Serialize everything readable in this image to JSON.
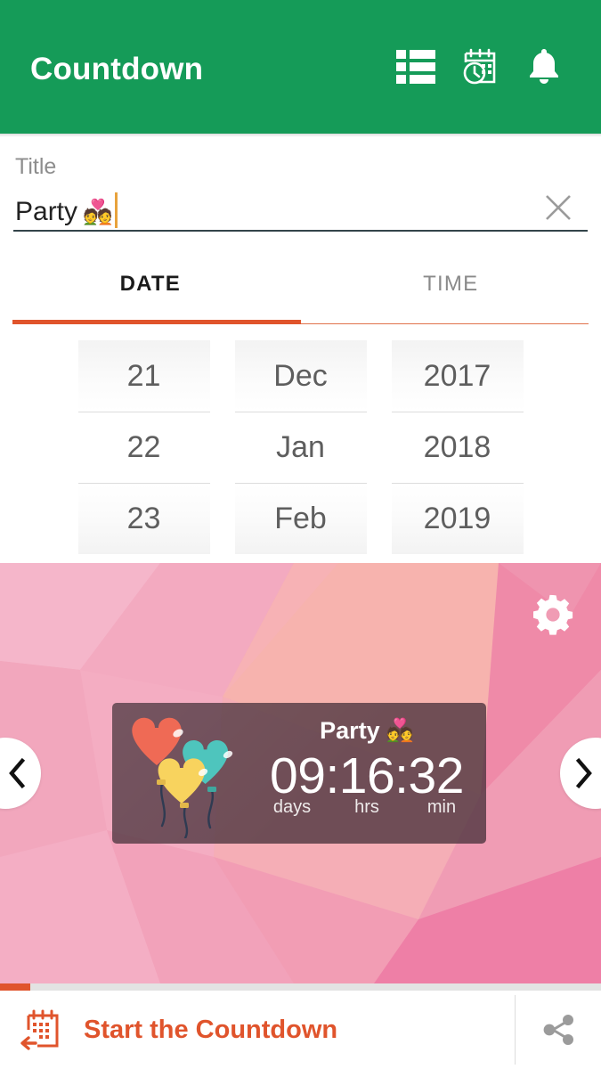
{
  "appbar": {
    "title": "Countdown",
    "actions": [
      {
        "name": "list-icon",
        "label": "List"
      },
      {
        "name": "calendar-clock-icon",
        "label": "Events"
      },
      {
        "name": "bell-icon",
        "label": "Notifications"
      }
    ]
  },
  "title_field": {
    "label": "Title",
    "value": "Party",
    "emoji": "💑",
    "placeholder": "Title",
    "clear_icon": "close-icon"
  },
  "tabs": [
    {
      "label": "DATE",
      "active": true
    },
    {
      "label": "TIME",
      "active": false
    }
  ],
  "date_picker": {
    "days": [
      "21",
      "22",
      "23"
    ],
    "months": [
      "Dec",
      "Jan",
      "Feb"
    ],
    "years": [
      "2017",
      "2018",
      "2019"
    ],
    "selected_day": "22",
    "selected_month": "Jan",
    "selected_year": "2018"
  },
  "preview": {
    "gear_icon": "gear-icon",
    "prev_icon": "chevron-left-icon",
    "next_icon": "chevron-right-icon",
    "widget": {
      "title": "Party",
      "emoji": "💑",
      "time": "09:16:32",
      "days": "09",
      "hours": "16",
      "minutes": "32",
      "units": [
        "days",
        "hrs",
        "min"
      ],
      "image": "heart-balloons"
    },
    "background": "pink-low-poly"
  },
  "bottom_bar": {
    "start_label": "Start the Countdown",
    "start_icon": "calendar-back-icon",
    "share_icon": "share-icon"
  },
  "colors": {
    "appbar_green": "#159b58",
    "accent_orange": "#e0542c",
    "caret_amber": "#e8a33d",
    "preview_pink": "#f2a0b6",
    "widget_card": "#4d353f"
  }
}
